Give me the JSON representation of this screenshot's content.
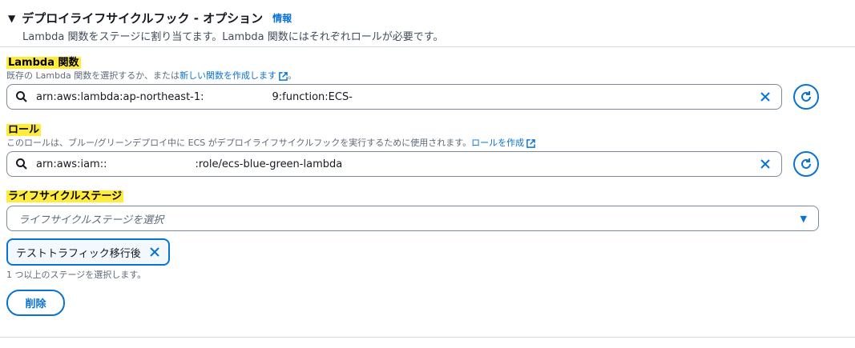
{
  "section": {
    "title": "デプロイライフサイクルフック - オプション",
    "info_link": "情報",
    "description": "Lambda 関数をステージに割り当てます。Lambda 関数にはそれぞれロールが必要です。"
  },
  "lambda": {
    "label": "Lambda 関数",
    "hint_prefix": "既存の Lambda 関数を選択するか、または",
    "hint_link": "新しい関数を作成します",
    "hint_suffix": "。",
    "value_part1": "arn:aws:lambda:ap-northeast-1:",
    "value_part2": "9:function:ECS-"
  },
  "role": {
    "label": "ロール",
    "hint_prefix": "このロールは、ブルー/グリーンデプロイ中に ECS がデプロイライフサイクルフックを実行するために使用されます。",
    "hint_link": "ロールを作成",
    "value_part1": "arn:aws:iam::",
    "value_part2": ":role/ecs-blue-green-lambda"
  },
  "stage": {
    "label": "ライフサイクルステージ",
    "placeholder": "ライフサイクルステージを選択",
    "selected_token": "テストトラフィック移行後",
    "hint": "1 つ以上のステージを選択します。"
  },
  "actions": {
    "delete_label": "削除"
  },
  "colors": {
    "accent": "#0972d3",
    "highlight": "#ffeb3b"
  }
}
